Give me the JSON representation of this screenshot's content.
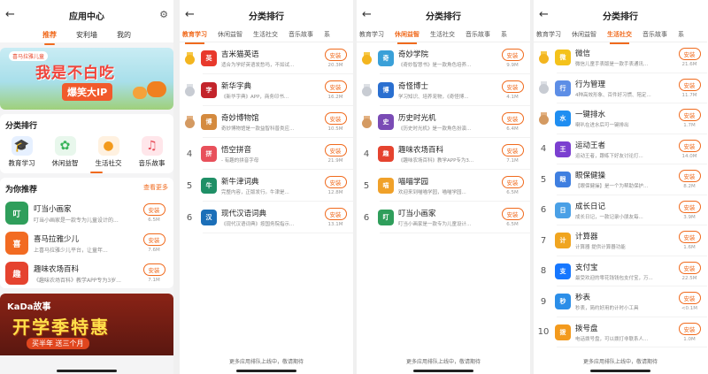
{
  "colors": {
    "accent": "#f06a1d",
    "background": "#f4f4f5"
  },
  "home": {
    "title": "应用中心",
    "tabs": [
      {
        "label": "推荐"
      },
      {
        "label": "安利墙"
      },
      {
        "label": "我的"
      }
    ],
    "banner": {
      "tag": "喜马拉雅儿童",
      "line1": "我是不白吃",
      "line2": "爆笑大IP"
    },
    "categories_title": "分类排行",
    "categories": [
      {
        "label": "教育学习",
        "icon": "graduation-cap-icon"
      },
      {
        "label": "休闲益智",
        "icon": "puzzle-icon"
      },
      {
        "label": "生活社交",
        "icon": "people-icon"
      },
      {
        "label": "音乐故事",
        "icon": "music-icon"
      }
    ],
    "recommend_title": "为你推荐",
    "recommend_more": "查看更多",
    "recommend": [
      {
        "name": "叮当小画家",
        "desc": "叮当小画家是一款专为儿童设计的...",
        "btn": "安装",
        "size": "6.5M",
        "color": "#2f9e5b",
        "abbr": "叮"
      },
      {
        "name": "喜马拉雅少儿",
        "desc": "上喜马拉雅少儿平台，让童年...",
        "btn": "安装",
        "size": "7.6M",
        "color": "#f26b22",
        "abbr": "喜"
      },
      {
        "name": "趣味农场百科",
        "desc": "《趣味农场百科》教学APP专为3岁...",
        "btn": "安装",
        "size": "7.1M",
        "color": "#e5432f",
        "abbr": "趣"
      }
    ],
    "promo": {
      "brand": "KaDa故事",
      "big": "开学季特惠",
      "sub": "买半年 送三个月"
    }
  },
  "rank_title": "分类排行",
  "rank_tabs": [
    "教育学习",
    "休闲益智",
    "生活社交",
    "音乐故事",
    "系"
  ],
  "footer": "更多应用排队上线中，敬请期待",
  "lists": [
    {
      "active_tab": 0,
      "items": [
        {
          "rank": "1",
          "name": "吉米猫英语",
          "desc": "适合为学好英语发愁吗，不如试...",
          "btn": "安装",
          "size": "20.3M",
          "color": "#e8392c",
          "abbr": "英"
        },
        {
          "rank": "2",
          "name": "新华字典",
          "desc": "《新华字典》APP，商务印书...",
          "btn": "安装",
          "size": "16.2M",
          "color": "#c3242b",
          "abbr": "字"
        },
        {
          "rank": "3",
          "name": "奇妙博物馆",
          "desc": "奇妙博物馆是一款益智科普类应...",
          "btn": "安装",
          "size": "10.5M",
          "color": "#d48a3e",
          "abbr": "博"
        },
        {
          "rank": "4",
          "name": "悟空拼音",
          "desc": "- 有趣的拼音字母",
          "btn": "安装",
          "size": "21.9M",
          "color": "#e8505b",
          "abbr": "拼"
        },
        {
          "rank": "5",
          "name": "新牛津词典",
          "desc": "完整内容，正版发行。牛津是...",
          "btn": "安装",
          "size": "12.8M",
          "color": "#1f8f66",
          "abbr": "牛"
        },
        {
          "rank": "6",
          "name": "现代汉语词典",
          "desc": "《现代汉语词典》按国务院指示...",
          "btn": "安装",
          "size": "13.1M",
          "color": "#1b6fb8",
          "abbr": "汉"
        }
      ]
    },
    {
      "active_tab": 1,
      "items": [
        {
          "rank": "1",
          "name": "奇妙学院",
          "desc": "《奇妙智慧书》是一款角色培养...",
          "btn": "安装",
          "size": "9.9M",
          "color": "#3aa0d8",
          "abbr": "奇"
        },
        {
          "rank": "2",
          "name": "奇怪博士",
          "desc": "学习知识、培养宠物，《奇怪博...",
          "btn": "安装",
          "size": "4.1M",
          "color": "#2a6fd0",
          "abbr": "博"
        },
        {
          "rank": "3",
          "name": "历史时光机",
          "desc": "《历史时光机》是一款角色扮演...",
          "btn": "安装",
          "size": "6.4M",
          "color": "#7a4bb5",
          "abbr": "史"
        },
        {
          "rank": "4",
          "name": "趣味农场百科",
          "desc": "《趣味农场百科》教学APP专为3...",
          "btn": "安装",
          "size": "7.1M",
          "color": "#e5432f",
          "abbr": "趣"
        },
        {
          "rank": "5",
          "name": "喵喵学园",
          "desc": "欢迎来到喵喵学园，喵喵学园...",
          "btn": "安装",
          "size": "6.5M",
          "color": "#f0a12a",
          "abbr": "喵"
        },
        {
          "rank": "6",
          "name": "叮当小画家",
          "desc": "叮当小画家是一款专为儿童设计...",
          "btn": "安装",
          "size": "6.5M",
          "color": "#2f9e5b",
          "abbr": "叮"
        }
      ]
    },
    {
      "active_tab": 2,
      "items": [
        {
          "rank": "1",
          "name": "微信",
          "desc": "微信儿童手表版是一款手表通讯...",
          "btn": "安装",
          "size": "21.6M",
          "color": "#f4c21b",
          "abbr": "微"
        },
        {
          "rank": "2",
          "name": "行为管理",
          "desc": "4种高效形象、百件好习惯、陪定...",
          "btn": "安装",
          "size": "11.7M",
          "color": "#5d8ee6",
          "abbr": "行"
        },
        {
          "rank": "3",
          "name": "一键排水",
          "desc": "喇叭在进水后可一键排出",
          "btn": "安装",
          "size": "1.7M",
          "color": "#1f8ef1",
          "abbr": "水"
        },
        {
          "rank": "4",
          "name": "运动王者",
          "desc": "运动王者，跟练下好友讨论打...",
          "btn": "安装",
          "size": "14.0M",
          "color": "#7b3fd0",
          "abbr": "王"
        },
        {
          "rank": "5",
          "name": "眼保健操",
          "desc": "【眼保健操】是一个为帮助保护...",
          "btn": "安装",
          "size": "8.2M",
          "color": "#3f7fe0",
          "abbr": "眼"
        },
        {
          "rank": "6",
          "name": "成长日记",
          "desc": "成长日记，一款记录小朋友每...",
          "btn": "安装",
          "size": "3.9M",
          "color": "#4aa0e6",
          "abbr": "日"
        },
        {
          "rank": "7",
          "name": "计算器",
          "desc": "计算器 提供计算器功能",
          "btn": "安装",
          "size": "1.6M",
          "color": "#f0a520",
          "abbr": "计"
        },
        {
          "rank": "8",
          "name": "支付宝",
          "desc": "最受欢迎的零花钱钱包支付宝，万...",
          "btn": "安装",
          "size": "22.5M",
          "color": "#1677ff",
          "abbr": "支"
        },
        {
          "rank": "9",
          "name": "秒表",
          "desc": "秒表，简约好用的计时小工具",
          "btn": "安装",
          "size": "<0.1M",
          "color": "#2b8ee8",
          "abbr": "秒"
        },
        {
          "rank": "10",
          "name": "拨号盘",
          "desc": "电话拨号盘，可以拨打非联系人...",
          "btn": "安装",
          "size": "1.0M",
          "color": "#f39a1d",
          "abbr": "拨"
        }
      ]
    }
  ]
}
